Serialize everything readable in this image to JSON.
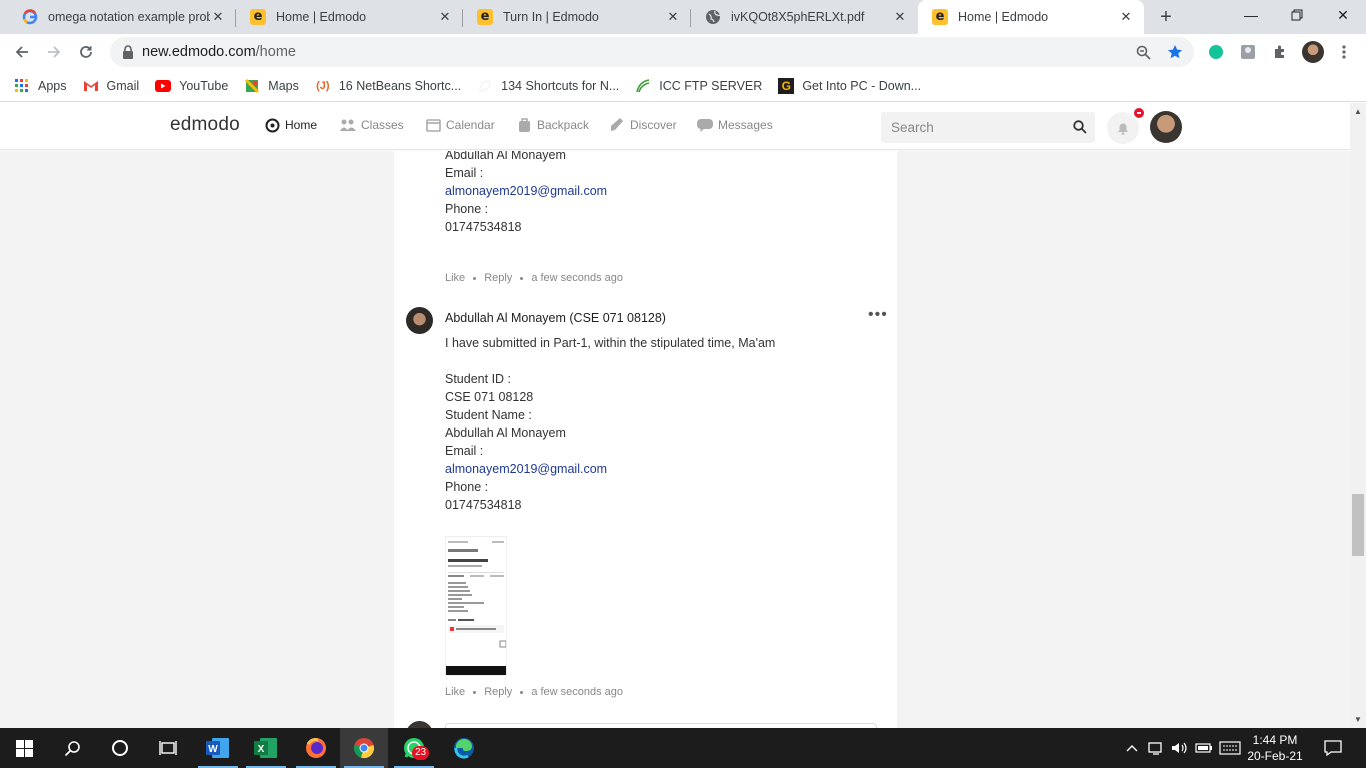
{
  "browser": {
    "tabs": [
      {
        "title": "omega notation example prob",
        "icon": "google-icon"
      },
      {
        "title": "Home | Edmodo",
        "icon": "edmodo-icon"
      },
      {
        "title": "Turn In | Edmodo",
        "icon": "edmodo-icon"
      },
      {
        "title": "ivKQOt8X5phERLXt.pdf",
        "icon": "globe-icon"
      },
      {
        "title": "Home | Edmodo",
        "icon": "edmodo-icon",
        "active": true
      }
    ],
    "url_host": "new.edmodo.com",
    "url_path": "/home",
    "bookmarks": [
      {
        "label": "Apps",
        "icon": "apps-grid-icon"
      },
      {
        "label": "Gmail",
        "icon": "gmail-icon"
      },
      {
        "label": "YouTube",
        "icon": "youtube-icon"
      },
      {
        "label": "Maps",
        "icon": "maps-icon"
      },
      {
        "label": "16 NetBeans Shortc...",
        "icon": "javatpoint-icon"
      },
      {
        "label": "134 Shortcuts for N...",
        "icon": "leaf-icon"
      },
      {
        "label": "ICC FTP SERVER",
        "icon": "icc-icon"
      },
      {
        "label": "Get Into PC - Down...",
        "icon": "getintopc-icon"
      }
    ]
  },
  "edmodo": {
    "logo": "edmodo",
    "nav": [
      {
        "label": "Home",
        "icon": "home-icon",
        "active": true
      },
      {
        "label": "Classes",
        "icon": "classes-icon"
      },
      {
        "label": "Calendar",
        "icon": "calendar-icon"
      },
      {
        "label": "Backpack",
        "icon": "backpack-icon"
      },
      {
        "label": "Discover",
        "icon": "discover-icon"
      },
      {
        "label": "Messages",
        "icon": "messages-icon"
      }
    ],
    "search_placeholder": "Search"
  },
  "comments": {
    "first_partial": {
      "lines": [
        "Abdullah Al Monayem",
        "Email :",
        "almonayem2019@gmail.com",
        "Phone :",
        "01747534818"
      ],
      "like": "Like",
      "reply": "Reply",
      "time": "a few seconds ago"
    },
    "second": {
      "author": "Abdullah Al Monayem (CSE 071 08128)",
      "message": "I have submitted in Part-1, within the stipulated time, Ma'am",
      "lines": [
        "Student ID :",
        "CSE 071 08128",
        "Student Name :",
        "Abdullah Al Monayem",
        "Email :",
        "almonayem2019@gmail.com",
        "Phone :",
        "01747534818"
      ],
      "like": "Like",
      "reply": "Reply",
      "time": "a few seconds ago",
      "attachment": "screenshot-thumbnail"
    }
  },
  "taskbar": {
    "whatsapp_badge": "23",
    "time": "1:44 PM",
    "date": "20-Feb-21"
  },
  "colors": {
    "link": "#1f3a93",
    "edmodo_yellow": "#ffc02f",
    "notification_red": "#e8132b"
  }
}
